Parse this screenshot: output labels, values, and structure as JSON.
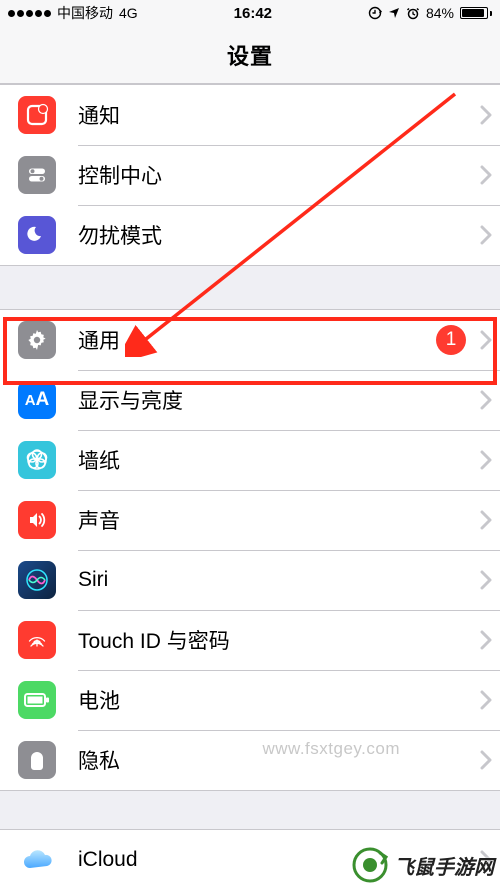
{
  "statusbar": {
    "carrier": "中国移动",
    "network": "4G",
    "time": "16:42",
    "lock": true,
    "location": true,
    "alarm": true,
    "battery_pct": "84%"
  },
  "header": {
    "title": "设置"
  },
  "sections": [
    [
      {
        "key": "notifications",
        "label": "通知",
        "icon": "notifications-icon"
      },
      {
        "key": "controlcenter",
        "label": "控制中心",
        "icon": "controlcenter-icon"
      },
      {
        "key": "dnd",
        "label": "勿扰模式",
        "icon": "dnd-icon"
      }
    ],
    [
      {
        "key": "general",
        "label": "通用",
        "icon": "general-icon",
        "badge": "1"
      },
      {
        "key": "display",
        "label": "显示与亮度",
        "icon": "display-icon"
      },
      {
        "key": "wallpaper",
        "label": "墙纸",
        "icon": "wallpaper-icon"
      },
      {
        "key": "sounds",
        "label": "声音",
        "icon": "sounds-icon"
      },
      {
        "key": "siri",
        "label": "Siri",
        "icon": "siri-icon"
      },
      {
        "key": "touchid",
        "label": "Touch ID 与密码",
        "icon": "touchid-icon"
      },
      {
        "key": "battery",
        "label": "电池",
        "icon": "battery-icon"
      },
      {
        "key": "privacy",
        "label": "隐私",
        "icon": "privacy-icon"
      }
    ],
    [
      {
        "key": "icloud",
        "label": "iCloud",
        "icon": "icloud-icon"
      }
    ]
  ],
  "annotation": {
    "highlighted_key": "general"
  },
  "watermark": {
    "brand": "飞鼠手游网",
    "url": "www.fsxtgey.com"
  }
}
